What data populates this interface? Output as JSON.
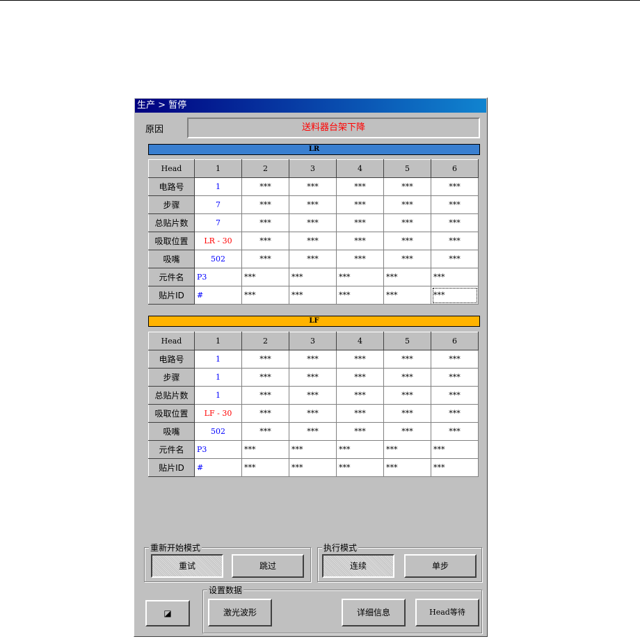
{
  "window": {
    "title": "生产 > 暂停"
  },
  "reason": {
    "label": "原因",
    "value": "送料器台架下降"
  },
  "colors": {
    "lr_band": "#3a7fd0",
    "lf_band": "#ffb300",
    "highlight_blue": "#0000ff",
    "highlight_red": "#ff0000"
  },
  "tables": [
    {
      "name": "LR",
      "header": [
        "Head",
        "1",
        "2",
        "3",
        "4",
        "5",
        "6"
      ],
      "rows": [
        {
          "label": "电路号",
          "cells": [
            "1",
            "***",
            "***",
            "***",
            "***",
            "***"
          ]
        },
        {
          "label": "步骤",
          "cells": [
            "7",
            "***",
            "***",
            "***",
            "***",
            "***"
          ]
        },
        {
          "label": "总贴片数",
          "cells": [
            "7",
            "***",
            "***",
            "***",
            "***",
            "***"
          ]
        },
        {
          "label": "吸取位置",
          "cells": [
            "LR - 30",
            "***",
            "***",
            "***",
            "***",
            "***"
          ]
        },
        {
          "label": "吸嘴",
          "cells": [
            "502",
            "***",
            "***",
            "***",
            "***",
            "***"
          ]
        },
        {
          "label": "元件名",
          "cells": [
            "P3",
            "***",
            "***",
            "***",
            "***",
            "***"
          ]
        },
        {
          "label": "贴片ID",
          "cells": [
            "#",
            "***",
            "***",
            "***",
            "***",
            "***"
          ]
        }
      ]
    },
    {
      "name": "LF",
      "header": [
        "Head",
        "1",
        "2",
        "3",
        "4",
        "5",
        "6"
      ],
      "rows": [
        {
          "label": "电路号",
          "cells": [
            "1",
            "***",
            "***",
            "***",
            "***",
            "***"
          ]
        },
        {
          "label": "步骤",
          "cells": [
            "1",
            "***",
            "***",
            "***",
            "***",
            "***"
          ]
        },
        {
          "label": "总贴片数",
          "cells": [
            "1",
            "***",
            "***",
            "***",
            "***",
            "***"
          ]
        },
        {
          "label": "吸取位置",
          "cells": [
            "LF - 30",
            "***",
            "***",
            "***",
            "***",
            "***"
          ]
        },
        {
          "label": "吸嘴",
          "cells": [
            "502",
            "***",
            "***",
            "***",
            "***",
            "***"
          ]
        },
        {
          "label": "元件名",
          "cells": [
            "P3",
            "***",
            "***",
            "***",
            "***",
            "***"
          ]
        },
        {
          "label": "贴片ID",
          "cells": [
            "#",
            "***",
            "***",
            "***",
            "***",
            "***"
          ]
        }
      ]
    }
  ],
  "restart_mode": {
    "title": "重新开始模式",
    "retry": "重试",
    "skip": "跳过"
  },
  "exec_mode": {
    "title": "执行模式",
    "continuous": "连续",
    "single_step": "单步"
  },
  "settings": {
    "title": "设置数据",
    "laser_waveform": "激光波形",
    "details": "详细信息",
    "head_wait": "Head等待"
  },
  "minimize_button": {
    "glyph": "◪"
  }
}
